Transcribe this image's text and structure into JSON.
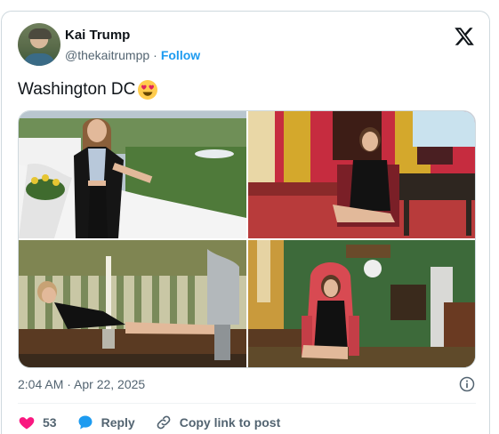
{
  "author": {
    "name": "Kai Trump",
    "handle": "@thekaitrumpp",
    "separator": "·",
    "follow_label": "Follow"
  },
  "tweet": {
    "text": "Washington DC",
    "emoji": "heart-eyes-emoji"
  },
  "media": {
    "count": 4
  },
  "meta": {
    "timestamp": "2:04 AM · Apr 22, 2025"
  },
  "actions": {
    "like_count": "53",
    "reply_label": "Reply",
    "copy_link_label": "Copy link to post"
  },
  "colors": {
    "accent": "#1d9bf0",
    "like": "#f91880",
    "text": "#0f1419",
    "secondary": "#536471"
  }
}
